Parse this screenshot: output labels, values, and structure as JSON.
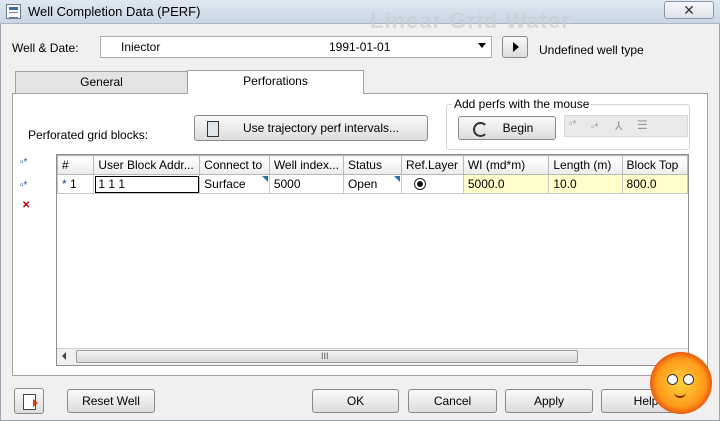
{
  "window": {
    "title": "Well Completion Data (PERF)",
    "close_glyph": "✕",
    "background_title": "Linear Grid Water"
  },
  "well": {
    "label": "Well & Date:",
    "name": "Iniector",
    "date": "1991-01-01",
    "type_text": "Undefined well type"
  },
  "tabs": [
    {
      "label": "General"
    },
    {
      "label": "Perforations"
    }
  ],
  "perforations": {
    "grid_label": "Perforated grid blocks:",
    "trajectory_button": "Use trajectory perf intervals...",
    "mouse_group_title": "Add perfs with the mouse",
    "begin_button": "Begin"
  },
  "table": {
    "columns": [
      "#",
      "User Block Addr...",
      "Connect to",
      "Well index...",
      "Status",
      "Ref.Layer",
      "WI (md*m)",
      "Length (m)",
      "Block Top"
    ],
    "rows": [
      {
        "marker": "*",
        "num": "1",
        "block": "1 1 1",
        "connect": "Surface",
        "well_index": "5000",
        "status": "Open",
        "ref_layer": true,
        "wi": "5000.0",
        "length": "10.0",
        "block_top": "800.0"
      }
    ],
    "scroll_grip": "III"
  },
  "buttons": {
    "reset": "Reset Well",
    "ok": "OK",
    "cancel": "Cancel",
    "apply": "Apply",
    "help": "Help"
  },
  "colors": {
    "highlight_cell": "#ffffcc",
    "link_triangle": "#2a6fb0"
  }
}
